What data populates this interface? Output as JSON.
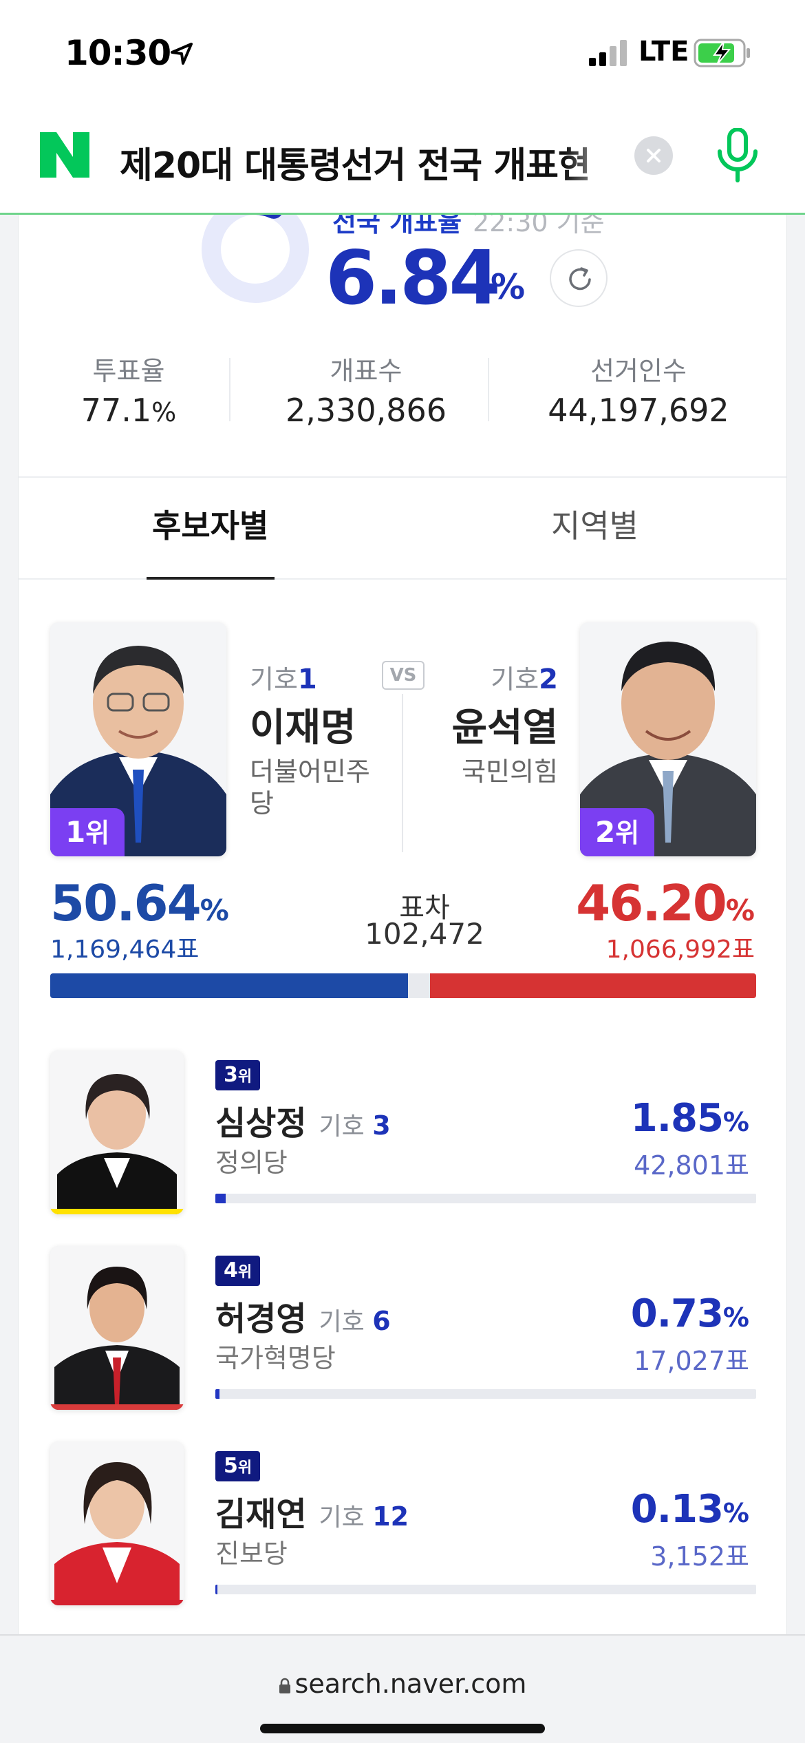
{
  "status_bar": {
    "time": "10:30",
    "network": "LTE",
    "icons": [
      "location-arrow-icon",
      "signal-icon",
      "battery-charging-icon"
    ]
  },
  "search": {
    "query": "제20대 대통령선거 전국 개표현",
    "logo": "N",
    "icons": [
      "clear-icon",
      "mic-icon"
    ],
    "accent": "#03c75a"
  },
  "summary": {
    "label": "전국 개표율",
    "time": "22:30 기준",
    "rate_value": "6.84",
    "rate_unit": "%",
    "rate_fraction": 0.0684,
    "stats": [
      {
        "label": "투표율",
        "value": "77.1",
        "unit": "%"
      },
      {
        "label": "개표수",
        "value": "2,330,866"
      },
      {
        "label": "선거인수",
        "value": "44,197,692"
      }
    ]
  },
  "tabs": [
    {
      "label": "후보자별",
      "active": true
    },
    {
      "label": "지역별",
      "active": false
    }
  ],
  "head_to_head": {
    "vs": "VS",
    "margin_label": "표차",
    "margin_value": "102,472",
    "left": {
      "rank": "1",
      "rank_suffix": "위",
      "symbol_label": "기호",
      "symbol": "1",
      "name": "이재명",
      "party": "더불어민주당",
      "pct": "50.64",
      "pct_unit": "%",
      "votes": "1,169,464표",
      "color": "#1d4aa6",
      "share": 50.64
    },
    "right": {
      "rank": "2",
      "rank_suffix": "위",
      "symbol_label": "기호",
      "symbol": "2",
      "name": "윤석열",
      "party": "국민의힘",
      "pct": "46.20",
      "pct_unit": "%",
      "votes": "1,066,992표",
      "color": "#d63333",
      "share": 46.2
    }
  },
  "others": [
    {
      "rank": "3",
      "rank_suffix": "위",
      "name": "심상정",
      "symbol_label": "기호",
      "symbol": "3",
      "party": "정의당",
      "pct": "1.85",
      "pct_unit": "%",
      "votes": "42,801표",
      "share": 1.85,
      "party_color": "#ffe100"
    },
    {
      "rank": "4",
      "rank_suffix": "위",
      "name": "허경영",
      "symbol_label": "기호",
      "symbol": "6",
      "party": "국가혁명당",
      "pct": "0.73",
      "pct_unit": "%",
      "votes": "17,027표",
      "share": 0.73,
      "party_color": "#d93b3b"
    },
    {
      "rank": "5",
      "rank_suffix": "위",
      "name": "김재연",
      "symbol_label": "기호",
      "symbol": "12",
      "party": "진보당",
      "pct": "0.13",
      "pct_unit": "%",
      "votes": "3,152표",
      "share": 0.13,
      "party_color": "#d4202f"
    }
  ],
  "browser": {
    "url": "search.naver.com"
  }
}
